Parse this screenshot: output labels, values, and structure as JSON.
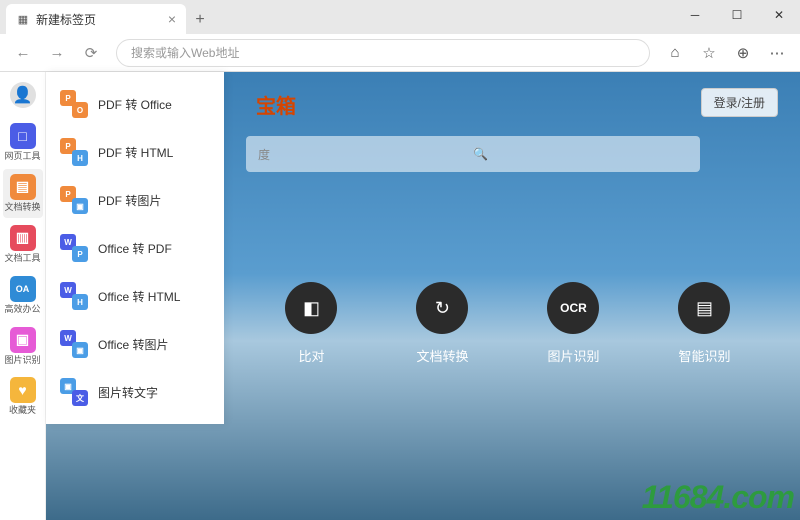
{
  "window": {
    "tab_title": "新建标签页"
  },
  "toolbar": {
    "placeholder": "搜索或输入Web地址"
  },
  "leftbar": {
    "items": [
      {
        "label": "网页工具",
        "color": "#4b5de6",
        "glyph": "□"
      },
      {
        "label": "文档转换",
        "color": "#f08a3c",
        "glyph": "▤"
      },
      {
        "label": "文档工具",
        "color": "#e64b5d",
        "glyph": "▥"
      },
      {
        "label": "高效办公",
        "color": "#2f8bd6",
        "glyph": "OA"
      },
      {
        "label": "图片识别",
        "color": "#e65bd6",
        "glyph": "▣"
      },
      {
        "label": "收藏夹",
        "color": "#f5b63c",
        "glyph": "♥"
      }
    ],
    "active_index": 1
  },
  "flyout": {
    "items": [
      {
        "label": "PDF 转 Office",
        "a": "#f08a3c",
        "b": "#f08a3c",
        "ta": "P",
        "tb": "O"
      },
      {
        "label": "PDF 转 HTML",
        "a": "#f08a3c",
        "b": "#4b9de6",
        "ta": "P",
        "tb": "H"
      },
      {
        "label": "PDF 转图片",
        "a": "#f08a3c",
        "b": "#4b9de6",
        "ta": "P",
        "tb": "▣"
      },
      {
        "label": "Office 转 PDF",
        "a": "#4b5de6",
        "b": "#4b9de6",
        "ta": "W",
        "tb": "P"
      },
      {
        "label": "Office 转 HTML",
        "a": "#4b5de6",
        "b": "#4b9de6",
        "ta": "W",
        "tb": "H"
      },
      {
        "label": "Office 转图片",
        "a": "#4b5de6",
        "b": "#4b9de6",
        "ta": "W",
        "tb": "▣"
      },
      {
        "label": "图片转文字",
        "a": "#4b9de6",
        "b": "#4b5de6",
        "ta": "▣",
        "tb": "文"
      }
    ]
  },
  "page": {
    "brand": "宝箱",
    "login": "登录/注册",
    "search_hint": "度",
    "tiles": [
      {
        "label": "比对",
        "glyph": "◧"
      },
      {
        "label": "文档转换",
        "glyph": "↻"
      },
      {
        "label": "图片识别",
        "glyph": "OCR"
      },
      {
        "label": "智能识别",
        "glyph": "▤"
      }
    ]
  },
  "watermark": "11684.com"
}
